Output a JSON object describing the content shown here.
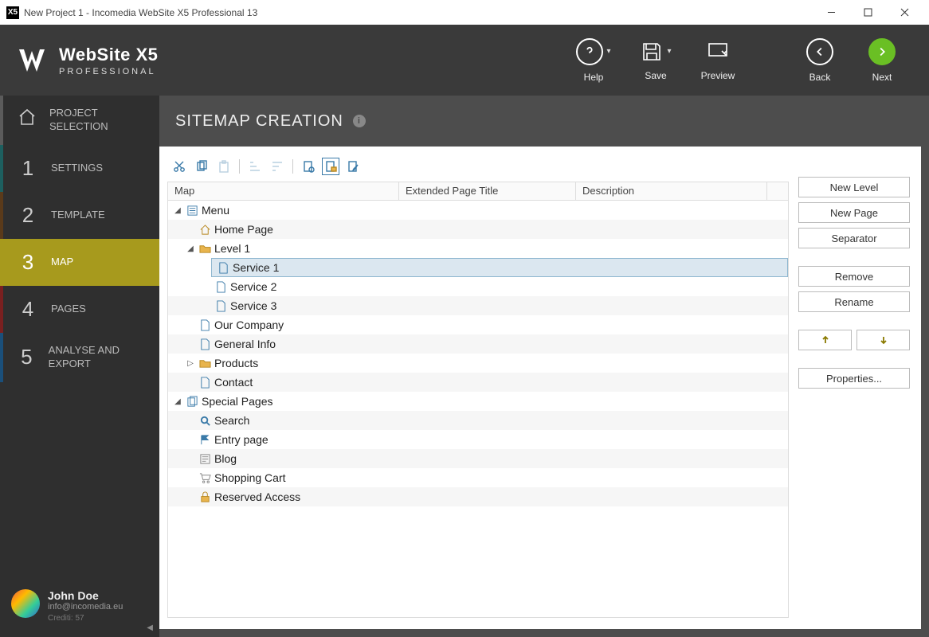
{
  "window_title": "New Project 1 - Incomedia WebSite X5 Professional 13",
  "brand": {
    "name": "WebSite X5",
    "edition": "PROFESSIONAL"
  },
  "header_buttons": {
    "help": "Help",
    "save": "Save",
    "preview": "Preview",
    "back": "Back",
    "next": "Next"
  },
  "sidebar": {
    "steps": [
      {
        "label": "PROJECT SELECTION"
      },
      {
        "label": "SETTINGS"
      },
      {
        "label": "TEMPLATE"
      },
      {
        "label": "MAP"
      },
      {
        "label": "PAGES"
      },
      {
        "label": "ANALYSE AND EXPORT"
      }
    ],
    "user": {
      "name": "John Doe",
      "email": "info@incomedia.eu",
      "credits": "Crediti: 57"
    }
  },
  "page": {
    "title": "SITEMAP CREATION"
  },
  "columns": {
    "map": "Map",
    "extended": "Extended Page Title",
    "description": "Description"
  },
  "tree": {
    "menu": "Menu",
    "home": "Home Page",
    "level1": "Level 1",
    "service1": "Service 1",
    "service2": "Service 2",
    "service3": "Service 3",
    "our_company": "Our Company",
    "general_info": "General Info",
    "products": "Products",
    "contact": "Contact",
    "special": "Special Pages",
    "search": "Search",
    "entry": "Entry page",
    "blog": "Blog",
    "cart": "Shopping Cart",
    "reserved": "Reserved Access"
  },
  "actions": {
    "new_level": "New Level",
    "new_page": "New Page",
    "separator": "Separator",
    "remove": "Remove",
    "rename": "Rename",
    "properties": "Properties..."
  },
  "step_numbers": {
    "s1": "1",
    "s2": "2",
    "s3": "3",
    "s4": "4",
    "s5": "5"
  }
}
